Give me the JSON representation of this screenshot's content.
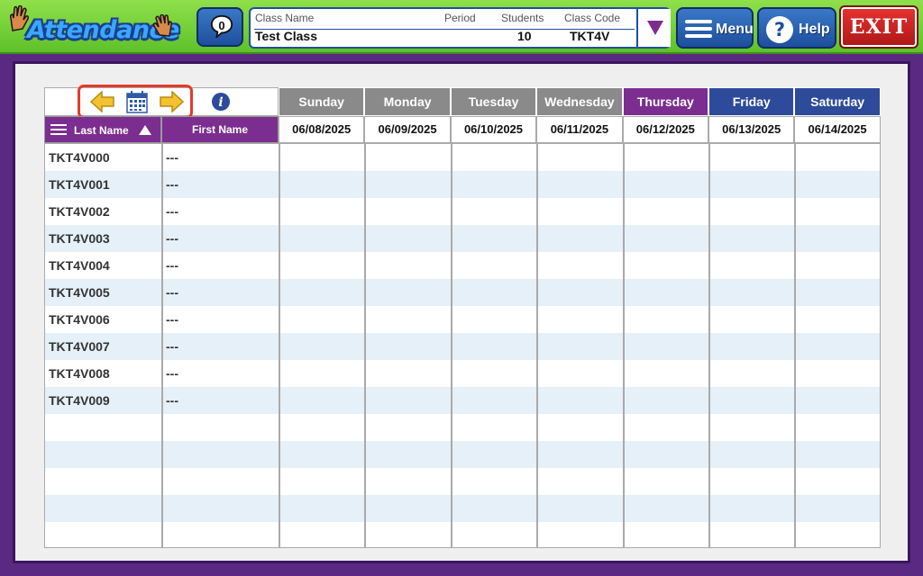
{
  "app": {
    "title": "Attendance"
  },
  "toolbar": {
    "message_count": "0",
    "menu_label": "Menu",
    "help_label": "Help",
    "exit_label": "EXIT"
  },
  "class_info": {
    "class_name_label": "Class Name",
    "class_name": "Test Class",
    "period_label": "Period",
    "period": "",
    "students_label": "Students",
    "students": "10",
    "class_code_label": "Class Code",
    "class_code": "TKT4V"
  },
  "table": {
    "last_name_header": "Last Name",
    "first_name_header": "First Name",
    "days": [
      {
        "name": "Sunday",
        "date": "06/08/2025",
        "color": "#8a8a8a"
      },
      {
        "name": "Monday",
        "date": "06/09/2025",
        "color": "#8a8a8a"
      },
      {
        "name": "Tuesday",
        "date": "06/10/2025",
        "color": "#8a8a8a"
      },
      {
        "name": "Wednesday",
        "date": "06/11/2025",
        "color": "#8a8a8a"
      },
      {
        "name": "Thursday",
        "date": "06/12/2025",
        "color": "#7b2e90"
      },
      {
        "name": "Friday",
        "date": "06/13/2025",
        "color": "#2e4a9a"
      },
      {
        "name": "Saturday",
        "date": "06/14/2025",
        "color": "#2e4a9a"
      }
    ],
    "students": [
      {
        "last": "TKT4V000",
        "first": "---"
      },
      {
        "last": "TKT4V001",
        "first": "---"
      },
      {
        "last": "TKT4V002",
        "first": "---"
      },
      {
        "last": "TKT4V003",
        "first": "---"
      },
      {
        "last": "TKT4V004",
        "first": "---"
      },
      {
        "last": "TKT4V005",
        "first": "---"
      },
      {
        "last": "TKT4V006",
        "first": "---"
      },
      {
        "last": "TKT4V007",
        "first": "---"
      },
      {
        "last": "TKT4V008",
        "first": "---"
      },
      {
        "last": "TKT4V009",
        "first": "---"
      }
    ],
    "empty_rows": 5
  },
  "icons": {
    "prev": "left-arrow-icon",
    "next": "right-arrow-icon",
    "calendar": "calendar-icon",
    "info": "info-icon"
  }
}
